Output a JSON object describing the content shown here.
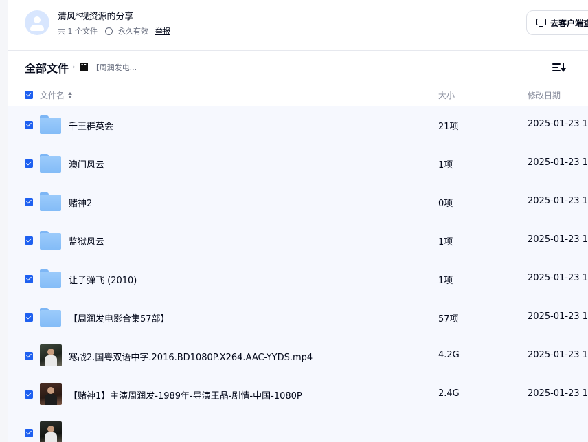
{
  "share": {
    "title": "清风*视资源的分享",
    "file_count": "共 1 个文件",
    "validity": "永久有效",
    "report": "举报",
    "client_button": "去客户端查"
  },
  "breadcrumb": {
    "root": "全部文件",
    "separator": "›",
    "current": "【周润发电..."
  },
  "list_header": {
    "name": "文件名",
    "size": "大小",
    "date": "修改日期"
  },
  "files": [
    {
      "type": "folder",
      "name": "千王群英会",
      "size": "21项",
      "date": "2025-01-23 1",
      "checked": true
    },
    {
      "type": "folder",
      "name": "澳门风云",
      "size": "1项",
      "date": "2025-01-23 1",
      "checked": true
    },
    {
      "type": "folder",
      "name": "赌神2",
      "size": "0项",
      "date": "2025-01-23 1",
      "checked": true
    },
    {
      "type": "folder",
      "name": "监狱风云",
      "size": "1项",
      "date": "2025-01-23 1",
      "checked": true
    },
    {
      "type": "folder",
      "name": "让子弹飞 (2010)",
      "size": "1项",
      "date": "2025-01-23 1",
      "checked": true
    },
    {
      "type": "folder",
      "name": "【周润发电影合集57部】",
      "size": "57项",
      "date": "2025-01-23 1",
      "checked": true
    },
    {
      "type": "video",
      "name": "寒战2.国粤双语中字.2016.BD1080P.X264.AAC-YYDS.mp4",
      "size": "4.2G",
      "date": "2025-01-23 1",
      "checked": true
    },
    {
      "type": "video",
      "name": "【赌神1】主演周润发-1989年-导演王晶-剧情-中国-1080P",
      "size": "2.4G",
      "date": "2025-01-23 1",
      "checked": true
    },
    {
      "type": "video",
      "name": "",
      "size": "",
      "date": "",
      "checked": true
    }
  ],
  "colors": {
    "accent": "#1e60f0",
    "row_bg": "#f6f8fe",
    "folder": "#8fc3f9",
    "text": "#03081a",
    "muted": "#878c9c"
  },
  "icons": {
    "avatar": "user-avatar-icon",
    "info": "info-circle-icon",
    "client": "monitor-icon",
    "breadcrumb": "clapperboard-icon",
    "sort": "sort-list-icon",
    "folder": "folder-icon",
    "video": "video-thumbnail"
  }
}
